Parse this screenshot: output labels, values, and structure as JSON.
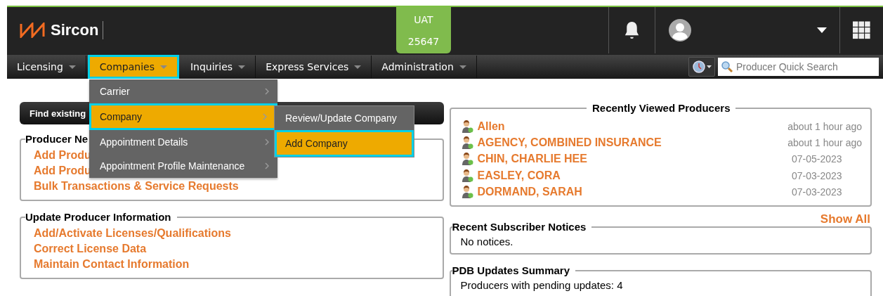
{
  "header": {
    "logo": "Sircon",
    "env_badge": {
      "lines": [
        "UAT",
        "25647"
      ]
    }
  },
  "nav": {
    "items": [
      {
        "label": "Licensing",
        "selected": false
      },
      {
        "label": "Companies",
        "selected": true
      },
      {
        "label": "Inquiries",
        "selected": false
      },
      {
        "label": "Express Services",
        "selected": false
      },
      {
        "label": "Administration",
        "selected": false
      }
    ],
    "search": {
      "placeholder": "Producer Quick Search"
    }
  },
  "menu": {
    "items": [
      {
        "label": "Carrier",
        "selected": false
      },
      {
        "label": "Company",
        "selected": true
      },
      {
        "label": "Appointment Details",
        "selected": false
      },
      {
        "label": "Appointment Profile Maintenance",
        "selected": false
      }
    ],
    "submenu": [
      {
        "label": "Review/Update Company",
        "selected": false
      },
      {
        "label": "Add Company",
        "selected": true
      }
    ]
  },
  "left": {
    "find_bar": "Find existing",
    "sections": [
      {
        "title": "Producer Ne",
        "links": [
          "Add Produ",
          "Add Produ",
          "Bulk Transactions & Service Requests"
        ]
      },
      {
        "title": "Update Producer Information",
        "links": [
          "Add/Activate Licenses/Qualifications",
          "Correct License Data",
          "Maintain Contact Information"
        ]
      }
    ]
  },
  "right": {
    "recent": {
      "title": "Recently Viewed Producers",
      "rows": [
        {
          "name": "Allen",
          "time": "about 1 hour ago"
        },
        {
          "name": "AGENCY, COMBINED INSURANCE",
          "time": "about 1 hour ago"
        },
        {
          "name": "CHIN, CHARLIE HEE",
          "time": "07-05-2023"
        },
        {
          "name": "EASLEY, CORA",
          "time": "07-03-2023"
        },
        {
          "name": "DORMAND, SARAH",
          "time": "07-03-2023"
        }
      ]
    },
    "show_all": "Show All",
    "notices": {
      "title": "Recent Subscriber Notices",
      "text": "No notices."
    },
    "pdb": {
      "title": "PDB Updates Summary",
      "text": "Producers with pending updates: 4"
    }
  }
}
